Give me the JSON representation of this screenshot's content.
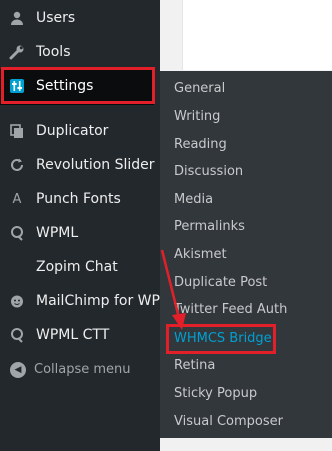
{
  "sidebar": {
    "items": [
      {
        "label": "Users",
        "icon": "user-icon"
      },
      {
        "label": "Tools",
        "icon": "wrench-icon"
      },
      {
        "label": "Settings",
        "icon": "settings-sliders-icon"
      },
      {
        "label": "Duplicator",
        "icon": "duplicator-icon"
      },
      {
        "label": "Revolution Slider",
        "icon": "refresh-icon"
      },
      {
        "label": "Punch Fonts",
        "icon": "font-a-icon"
      },
      {
        "label": "WPML",
        "icon": "wpml-icon"
      },
      {
        "label": "Zopim Chat",
        "icon": ""
      },
      {
        "label": "MailChimp for WP",
        "icon": "mailchimp-icon"
      },
      {
        "label": "WPML CTT",
        "icon": "wpml-icon"
      }
    ],
    "collapse_label": "Collapse menu"
  },
  "settings_submenu": {
    "items": [
      "General",
      "Writing",
      "Reading",
      "Discussion",
      "Media",
      "Permalinks",
      "Akismet",
      "Duplicate Post",
      "Twitter Feed Auth",
      "WHMCS Bridge",
      "Retina",
      "Sticky Popup",
      "Visual Composer"
    ],
    "highlighted": "WHMCS Bridge"
  },
  "colors": {
    "sidebar_bg": "#23282d",
    "submenu_bg": "#32373c",
    "active_link": "#00a0d2",
    "annotation_red": "#e3202a"
  }
}
